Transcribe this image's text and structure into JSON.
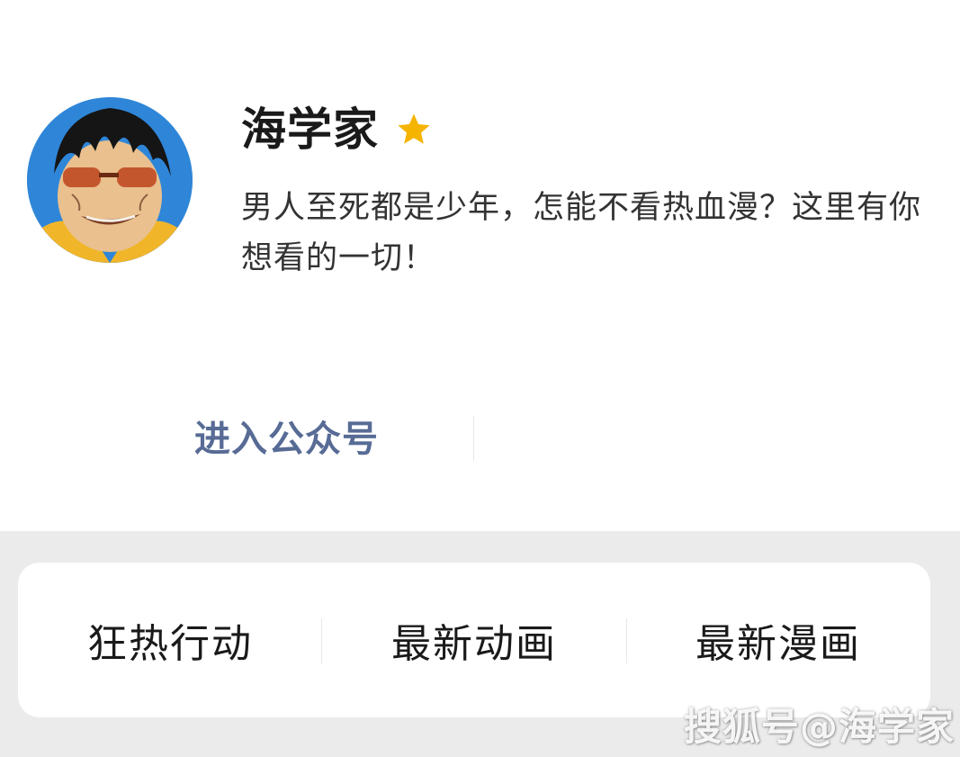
{
  "profile": {
    "name": "海学家",
    "verified_icon": "star-icon",
    "star_color": "#f5b400",
    "bio": "男人至死都是少年，怎能不看热血漫？这里有你想看的一切！"
  },
  "actions": {
    "enter_label": "进入公众号"
  },
  "menu": {
    "items": [
      {
        "label": "狂热行动"
      },
      {
        "label": "最新动画"
      },
      {
        "label": "最新漫画"
      }
    ]
  },
  "watermark": "搜狐号@海学家",
  "colors": {
    "link": "#576b95",
    "background": "#ebebeb"
  }
}
